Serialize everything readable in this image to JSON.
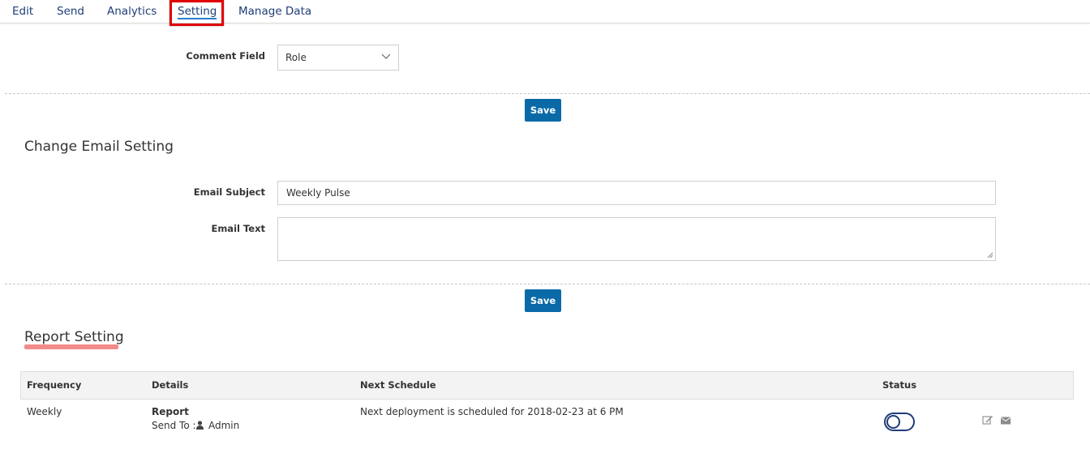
{
  "nav": {
    "tabs": [
      "Edit",
      "Send",
      "Analytics",
      "Setting",
      "Manage Data"
    ],
    "active": "Setting"
  },
  "comment": {
    "label": "Comment Field",
    "selected": "Role"
  },
  "save_label": "Save",
  "email_section": {
    "title": "Change Email Setting",
    "subject_label": "Email Subject",
    "subject_value": "Weekly Pulse",
    "text_label": "Email Text",
    "text_value": ""
  },
  "report": {
    "title": "Report Setting",
    "columns": [
      "Frequency",
      "Details",
      "Next Schedule",
      "Status"
    ],
    "rows": [
      {
        "frequency": "Weekly",
        "details_title": "Report",
        "send_to_label": "Send To :",
        "send_to_value": "Admin",
        "next_schedule": "Next deployment is scheduled for 2018-02-23 at 6 PM",
        "status_on": false
      }
    ]
  },
  "colors": {
    "primary_button": "#0a6aa8",
    "nav_text": "#1f3d78",
    "highlight_box": "#e00000",
    "report_underline": "#f28a8a"
  },
  "icons": [
    "chevron-down-icon",
    "user-icon",
    "edit-icon",
    "envelope-icon",
    "resize-grip-icon"
  ]
}
